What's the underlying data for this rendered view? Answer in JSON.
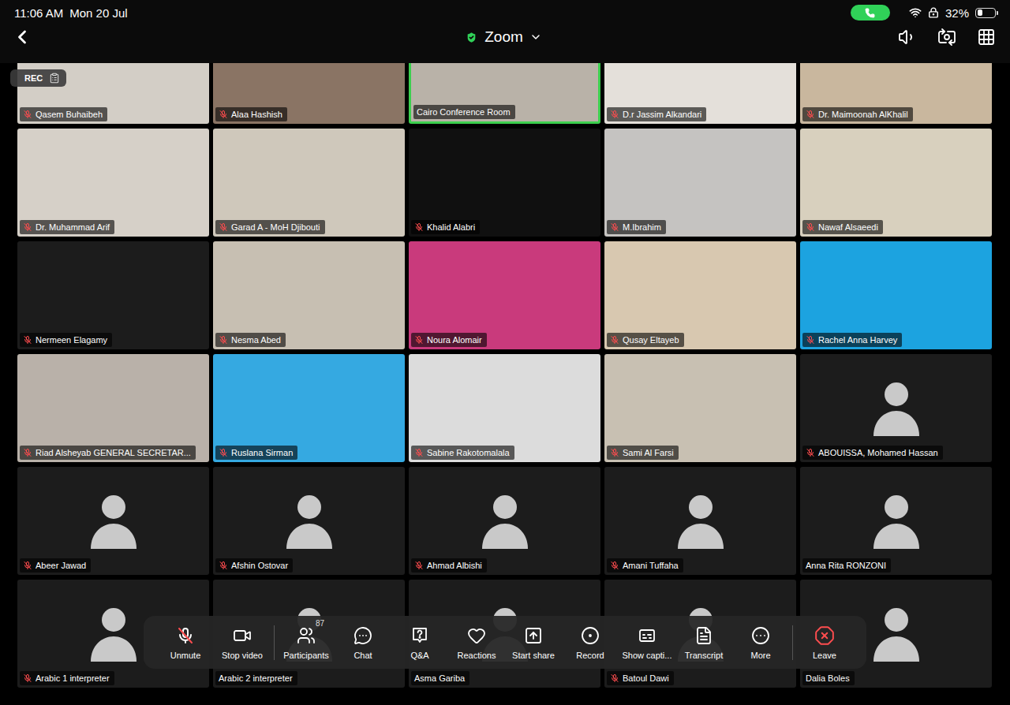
{
  "status_bar": {
    "time": "11:06 AM",
    "date": "Mon 20 Jul",
    "call_active": true,
    "battery": "32%",
    "battery_level": 0.32
  },
  "nav": {
    "title": "Zoom"
  },
  "rec_badge": {
    "label": "REC"
  },
  "tiles": [
    {
      "name": "Qasem Buhaibeh",
      "kind": "video",
      "color": "#d3cec6",
      "muted": true,
      "active": false
    },
    {
      "name": "Alaa Hashish",
      "kind": "video",
      "color": "#8a7464",
      "muted": true,
      "active": false
    },
    {
      "name": "Cairo Conference Room",
      "kind": "video",
      "color": "#b9b2a8",
      "muted": false,
      "active": true
    },
    {
      "name": "D.r Jassim Alkandari",
      "kind": "video",
      "color": "#e4e0da",
      "muted": true,
      "active": false
    },
    {
      "name": "Dr. Maimoonah AlKhalil",
      "kind": "video",
      "color": "#c9b79e",
      "muted": true,
      "active": false
    },
    {
      "name": "Dr. Muhammad Arif",
      "kind": "video",
      "color": "#d6d0c8",
      "muted": true,
      "active": false
    },
    {
      "name": "Garad A - MoH Djibouti",
      "kind": "video",
      "color": "#cfc8bb",
      "muted": true,
      "active": false
    },
    {
      "name": "Khalid Alabri",
      "kind": "video",
      "color": "#101010",
      "muted": true,
      "active": false
    },
    {
      "name": "M.Ibrahim",
      "kind": "video",
      "color": "#c5c3c1",
      "muted": true,
      "active": false
    },
    {
      "name": "Nawaf Alsaeedi",
      "kind": "video",
      "color": "#d8d0be",
      "muted": true,
      "active": false
    },
    {
      "name": "Nermeen Elagamy",
      "kind": "blank",
      "muted": true,
      "active": false
    },
    {
      "name": "Nesma Abed",
      "kind": "video",
      "color": "#c7bfb2",
      "muted": true,
      "active": false
    },
    {
      "name": "Noura Alomair",
      "kind": "video",
      "color": "#c93a7c",
      "muted": true,
      "active": false
    },
    {
      "name": "Qusay Eltayeb",
      "kind": "video",
      "color": "#d8c8b0",
      "muted": true,
      "active": false
    },
    {
      "name": "Rachel Anna Harvey",
      "kind": "video",
      "color": "#1ca3e0",
      "muted": true,
      "active": false
    },
    {
      "name": "Riad Alsheyab GENERAL SECRETAR...",
      "kind": "video",
      "color": "#b9b1a9",
      "muted": true,
      "active": false
    },
    {
      "name": "Ruslana Sirman",
      "kind": "video",
      "color": "#35a9e1",
      "muted": true,
      "active": false
    },
    {
      "name": "Sabine Rakotomalala",
      "kind": "video",
      "color": "#dcdcdc",
      "muted": true,
      "active": false
    },
    {
      "name": "Sami Al Farsi",
      "kind": "video",
      "color": "#c8c0b2",
      "muted": true,
      "active": false
    },
    {
      "name": "ABOUISSA, Mohamed Hassan",
      "kind": "avatar",
      "muted": true,
      "active": false
    },
    {
      "name": "Abeer Jawad",
      "kind": "avatar",
      "muted": true,
      "active": false
    },
    {
      "name": "Afshin Ostovar",
      "kind": "avatar",
      "muted": true,
      "active": false
    },
    {
      "name": "Ahmad Albishi",
      "kind": "avatar",
      "muted": true,
      "active": false
    },
    {
      "name": "Amani Tuffaha",
      "kind": "avatar",
      "muted": true,
      "active": false
    },
    {
      "name": "Anna Rita RONZONI",
      "kind": "avatar",
      "muted": false,
      "active": false
    },
    {
      "name": "Arabic 1 interpreter",
      "kind": "avatar",
      "muted": true,
      "active": false
    },
    {
      "name": "Arabic 2 interpreter",
      "kind": "avatar",
      "muted": false,
      "active": false
    },
    {
      "name": "Asma Gariba",
      "kind": "avatar",
      "muted": false,
      "active": false
    },
    {
      "name": "Batoul Dawi",
      "kind": "avatar",
      "muted": true,
      "active": false
    },
    {
      "name": "Dalia Boles",
      "kind": "avatar",
      "muted": false,
      "active": false
    }
  ],
  "toolbar": {
    "groups": [
      [
        {
          "label": "Unmute",
          "muted": true
        },
        {
          "label": "Stop video"
        }
      ],
      [
        {
          "label": "Participants",
          "badge": "87"
        },
        {
          "label": "Chat"
        },
        {
          "label": "Q&A"
        },
        {
          "label": "Reactions"
        },
        {
          "label": "Start share"
        },
        {
          "label": "Record"
        },
        {
          "label": "Show capti..."
        },
        {
          "label": "Transcript"
        },
        {
          "label": "More"
        }
      ],
      [
        {
          "label": "Leave",
          "danger": true
        }
      ]
    ]
  }
}
